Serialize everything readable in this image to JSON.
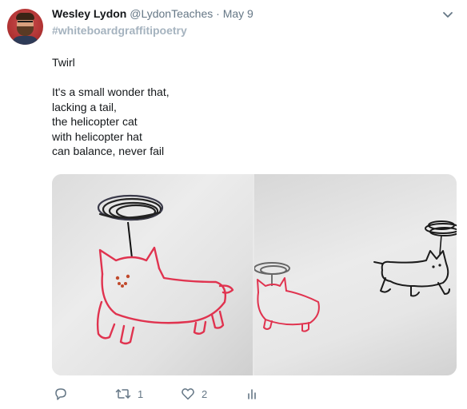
{
  "tweet": {
    "author_name": "Wesley Lydon",
    "author_handle": "@LydonTeaches",
    "separator": "·",
    "date": "May 9",
    "hashtag": "#whiteboardgraffitipoetry",
    "title_line": "Twirl",
    "poem_lines": [
      "It's a small wonder that,",
      "lacking a tail,",
      "the helicopter cat",
      "with helicopter hat",
      "can balance, never fail"
    ]
  },
  "actions": {
    "reply_count": "",
    "retweet_count": "1",
    "like_count": "2"
  },
  "icons": {
    "avatar": "avatar",
    "caret": "chevron-down-icon",
    "reply": "reply-icon",
    "retweet": "retweet-icon",
    "like": "heart-icon",
    "analytics": "analytics-icon"
  },
  "colors": {
    "name": "#14171a",
    "secondary": "#657786",
    "hashtag": "#a5b3bf",
    "cat_marker": "#e0334f"
  }
}
